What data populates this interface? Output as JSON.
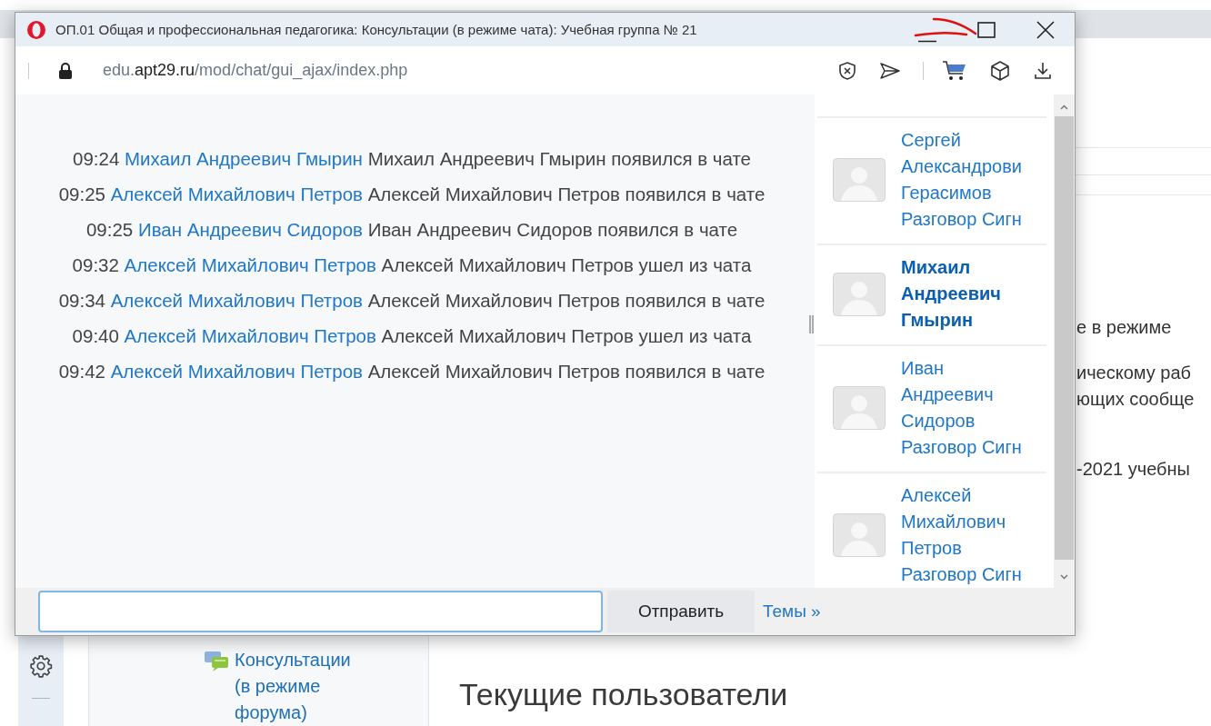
{
  "window": {
    "title": "ОП.01 Общая и профессиональная педагогика: Консультации (в режиме чата): Учебная группа № 21",
    "url": {
      "subdomain": "edu.",
      "domain": "apt29.ru",
      "path": "/mod/chat/gui_ajax/index.php"
    }
  },
  "messages": [
    {
      "time": "09:24",
      "user": "Михаил Андреевич Гмырин",
      "text": "Михаил Андреевич Гмырин появился в чате"
    },
    {
      "time": "09:25",
      "user": "Алексей Михайлович Петров",
      "text": "Алексей Михайлович Петров появился в чате"
    },
    {
      "time": "09:25",
      "user": "Иван Андреевич Сидоров",
      "text": "Иван Андреевич Сидоров появился в чате"
    },
    {
      "time": "09:32",
      "user": "Алексей Михайлович Петров",
      "text": "Алексей Михайлович Петров ушел из чата"
    },
    {
      "time": "09:34",
      "user": "Алексей Михайлович Петров",
      "text": "Алексей Михайлович Петров появился в чате"
    },
    {
      "time": "09:40",
      "user": "Алексей Михайлович Петров",
      "text": "Алексей Михайлович Петров ушел из чата"
    },
    {
      "time": "09:42",
      "user": "Алексей Михайлович Петров",
      "text": "Алексей Михайлович Петров появился в чате"
    }
  ],
  "users": [
    {
      "name": "Сергей Александрови Герасимов",
      "status": "Разговор Сигн",
      "current": false
    },
    {
      "name": "Михаил Андреевич Гмырин",
      "current": true
    },
    {
      "name": "Иван Андреевич Сидоров",
      "status": "Разговор Сигн",
      "current": false
    },
    {
      "name": "Алексей Михайлович Петров",
      "status": "Разговор Сигн",
      "current": false
    }
  ],
  "composer": {
    "send_button": "Отправить",
    "topics_link": "Темы »"
  },
  "background_page": {
    "nav_items": [
      "Консультации (в режиме форума)"
    ],
    "text_fragments": [
      "е в режиме",
      "ическому раб",
      "ющих сообще",
      "-2021 учебны"
    ],
    "heading": "Текущие пользователи"
  }
}
